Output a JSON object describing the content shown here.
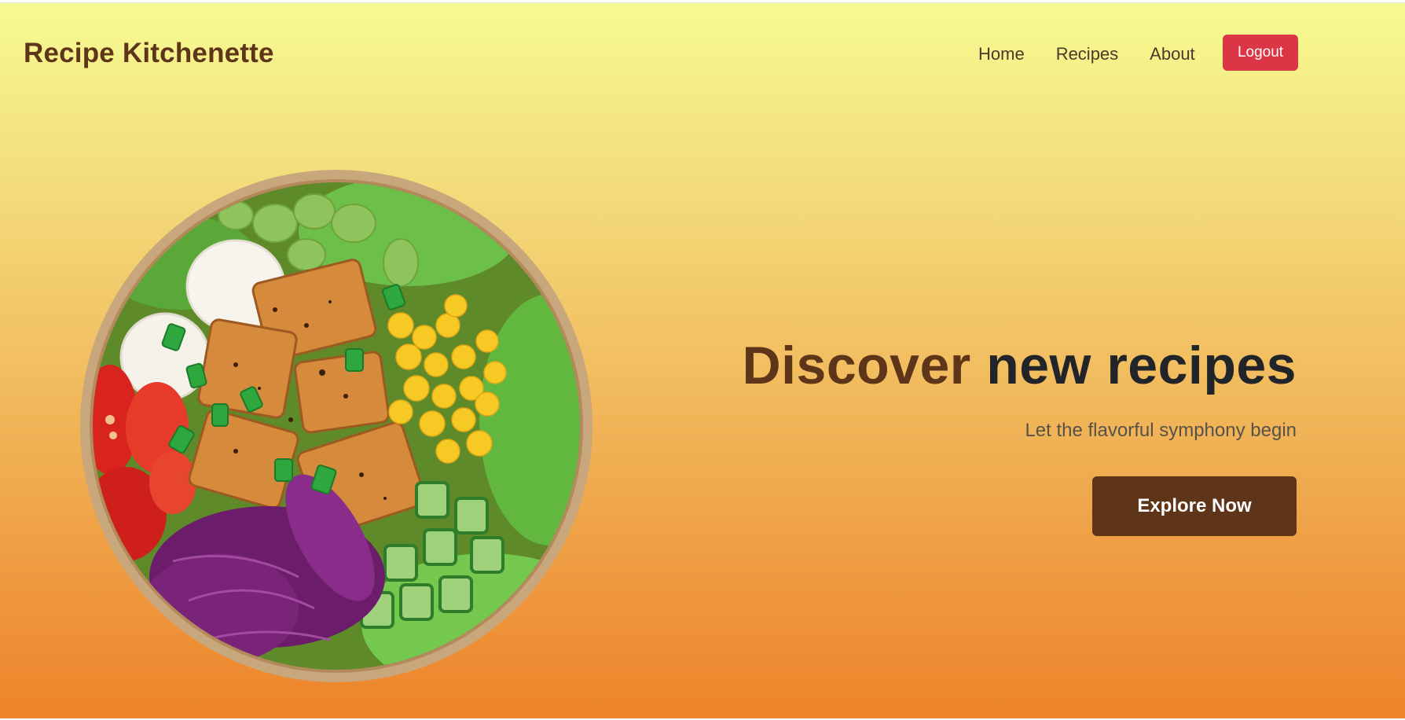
{
  "brand": {
    "name": "Recipe Kitchenette"
  },
  "nav": {
    "links": [
      {
        "label": "Home"
      },
      {
        "label": "Recipes"
      },
      {
        "label": "About"
      }
    ],
    "logout_label": "Logout"
  },
  "hero": {
    "title_part1": "Discover",
    "title_part2": "new recipes",
    "subtitle": "Let the flavorful symphony begin",
    "cta_label": "Explore Now",
    "image_icon": "salad-bowl-image"
  },
  "colors": {
    "brand": "#5e3518",
    "logout": "#dc3545",
    "gradient_top": "#f6fb92",
    "gradient_bottom": "#ee832a"
  }
}
